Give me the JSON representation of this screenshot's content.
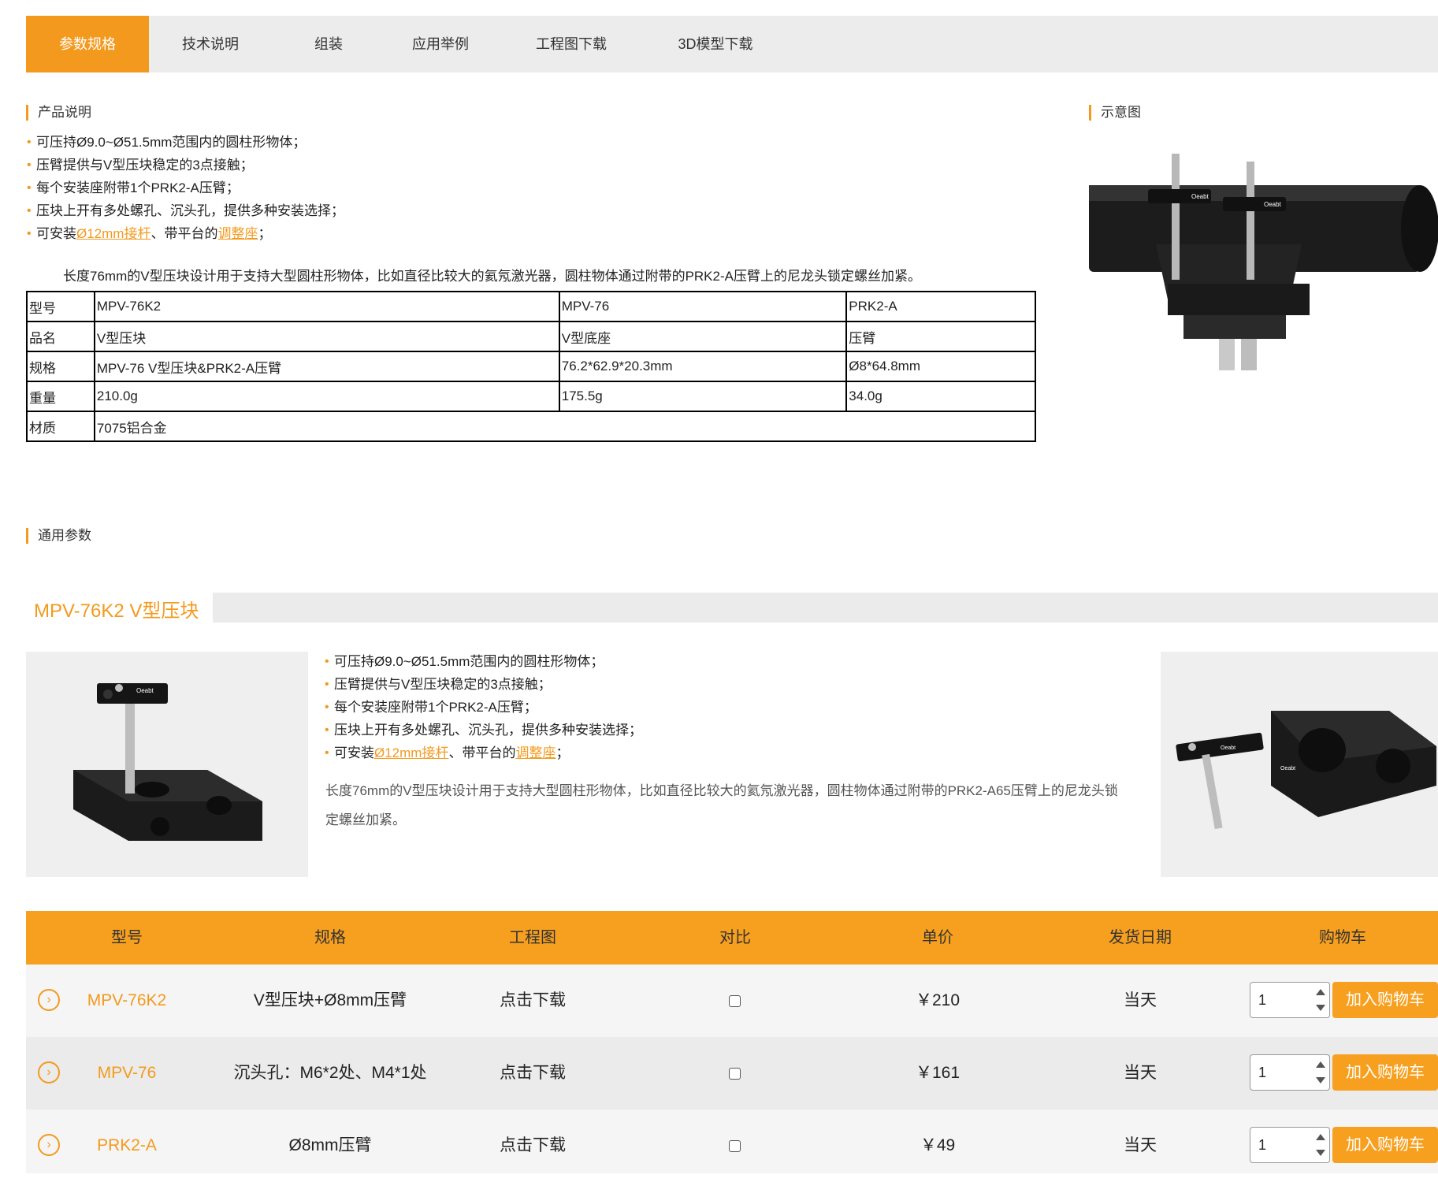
{
  "tabs": [
    "参数规格",
    "技术说明",
    "组装",
    "应用举例",
    "工程图下载",
    "3D模型下载"
  ],
  "section_titles": {
    "product_desc": "产品说明",
    "diagram": "示意图",
    "general_params": "通用参数"
  },
  "features": [
    {
      "pre": "可压持Ø9.0~Ø51.5mm范围内的圆柱形物体；"
    },
    {
      "pre": "压臂提供与V型压块稳定的3点接触；"
    },
    {
      "pre": "每个安装座附带1个PRK2-A压臂；"
    },
    {
      "pre": "压块上开有多处螺孔、沉头孔，提供多种安装选择；"
    },
    {
      "pre": "可安装",
      "link1": "Ø12mm接杆",
      "mid": "、带平台的",
      "link2": "调整座",
      "post": "；"
    }
  ],
  "description": "长度76mm的V型压块设计用于支持大型圆柱形物体，比如直径比较大的氦氖激光器，圆柱物体通过附带的PRK2-A压臂上的尼龙头锁定螺丝加紧。",
  "spec_table": {
    "rows": [
      {
        "label": "型号",
        "c1": "MPV-76K2",
        "c2": "MPV-76",
        "c3": "PRK2-A"
      },
      {
        "label": "品名",
        "c1": "V型压块",
        "c2": "V型底座",
        "c3": "压臂"
      },
      {
        "label": "规格",
        "c1": "MPV-76 V型压块&PRK2-A压臂",
        "c2": "76.2*62.9*20.3mm",
        "c3": "Ø8*64.8mm"
      },
      {
        "label": "重量",
        "c1": "210.0g",
        "c2": "175.5g",
        "c3": "34.0g"
      },
      {
        "label": "材质",
        "c1": "7075铝合金"
      }
    ]
  },
  "product_title": "MPV-76K2 V型压块",
  "product_features": [
    {
      "pre": "可压持Ø9.0~Ø51.5mm范围内的圆柱形物体；"
    },
    {
      "pre": "压臂提供与V型压块稳定的3点接触；"
    },
    {
      "pre": "每个安装座附带1个PRK2-A压臂；"
    },
    {
      "pre": "压块上开有多处螺孔、沉头孔，提供多种安装选择；"
    },
    {
      "pre": "可安装",
      "link1": "Ø12mm接杆",
      "mid": "、带平台的",
      "link2": "调整座",
      "post": "；"
    }
  ],
  "product_description": "长度76mm的V型压块设计用于支持大型圆柱形物体，比如直径比较大的氦氖激光器，圆柱物体通过附带的PRK2-A65压臂上的尼龙头锁定螺丝加紧。",
  "order_table": {
    "headers": [
      "型号",
      "规格",
      "工程图",
      "对比",
      "单价",
      "发货日期",
      "购物车"
    ],
    "rows": [
      {
        "model": "MPV-76K2",
        "spec": "V型压块+Ø8mm压臂",
        "drawing": "点击下载",
        "price": "￥210",
        "ship": "当天",
        "qty": "1",
        "button": "加入购物车"
      },
      {
        "model": "MPV-76",
        "spec": "沉头孔：M6*2处、M4*1处",
        "drawing": "点击下载",
        "price": "￥161",
        "ship": "当天",
        "qty": "1",
        "button": "加入购物车"
      },
      {
        "model": "PRK2-A",
        "spec": "Ø8mm压臂",
        "drawing": "点击下载",
        "price": "￥49",
        "ship": "当天",
        "qty": "1",
        "button": "加入购物车"
      }
    ]
  },
  "brand_mark": "Oeabt",
  "accent_color": "#f39a1e"
}
